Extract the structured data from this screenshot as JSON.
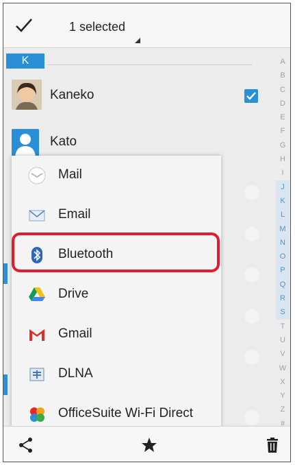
{
  "topbar": {
    "selected_label": "1 selected"
  },
  "contacts": {
    "section": "K",
    "items": [
      {
        "name": "Kaneko",
        "checked": true
      },
      {
        "name": "Kato",
        "checked": false
      }
    ]
  },
  "index": [
    "A",
    "B",
    "C",
    "D",
    "E",
    "F",
    "G",
    "H",
    "I",
    "J",
    "K",
    "L",
    "M",
    "N",
    "O",
    "P",
    "Q",
    "R",
    "S",
    "T",
    "U",
    "V",
    "W",
    "X",
    "Y",
    "Z",
    "#"
  ],
  "share_menu": {
    "items": [
      {
        "label": "Mail",
        "icon": "mail-icon"
      },
      {
        "label": "Email",
        "icon": "email-icon"
      },
      {
        "label": "Bluetooth",
        "icon": "bluetooth-icon",
        "highlighted": true
      },
      {
        "label": "Drive",
        "icon": "drive-icon"
      },
      {
        "label": "Gmail",
        "icon": "gmail-icon"
      },
      {
        "label": "DLNA",
        "icon": "dlna-icon"
      },
      {
        "label": "OfficeSuite Wi-Fi Direct",
        "icon": "officesuite-icon"
      }
    ]
  },
  "bottombar": {
    "icons": [
      "share-icon",
      "star-icon",
      "trash-icon"
    ]
  },
  "colors": {
    "accent": "#2b8fd6",
    "highlight_border": "#e41b2e"
  }
}
